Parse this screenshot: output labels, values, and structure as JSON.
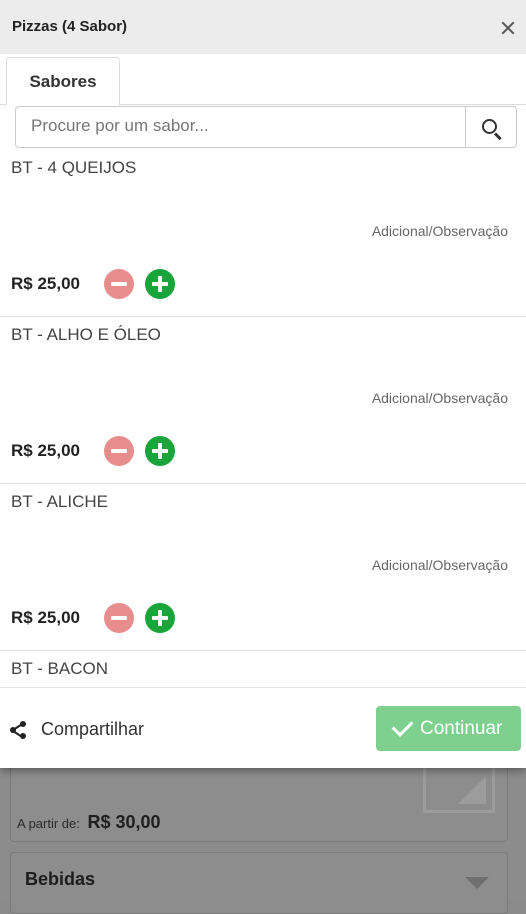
{
  "modal": {
    "title": "Pizzas (4 Sabor)",
    "tab_label": "Sabores",
    "search_placeholder": "Procure por um sabor...",
    "items": [
      {
        "name": "BT - 4 QUEIJOS",
        "note_label": "Adicional/Observação",
        "price": "R$ 25,00"
      },
      {
        "name": "BT - ALHO E ÓLEO",
        "note_label": "Adicional/Observação",
        "price": "R$ 25,00"
      },
      {
        "name": "BT - ALICHE",
        "note_label": "Adicional/Observação",
        "price": "R$ 25,00"
      },
      {
        "name": "BT - BACON",
        "note_label": "",
        "price": ""
      }
    ],
    "share_label": "Compartilhar",
    "continue_label": "Continuar"
  },
  "background": {
    "from_label": "A partir de:",
    "from_price": "R$ 30,00",
    "category_label": "Bebidas"
  },
  "colors": {
    "minus": "#e88d8d",
    "plus": "#1aa53a",
    "continue": "#7fcf8f"
  }
}
